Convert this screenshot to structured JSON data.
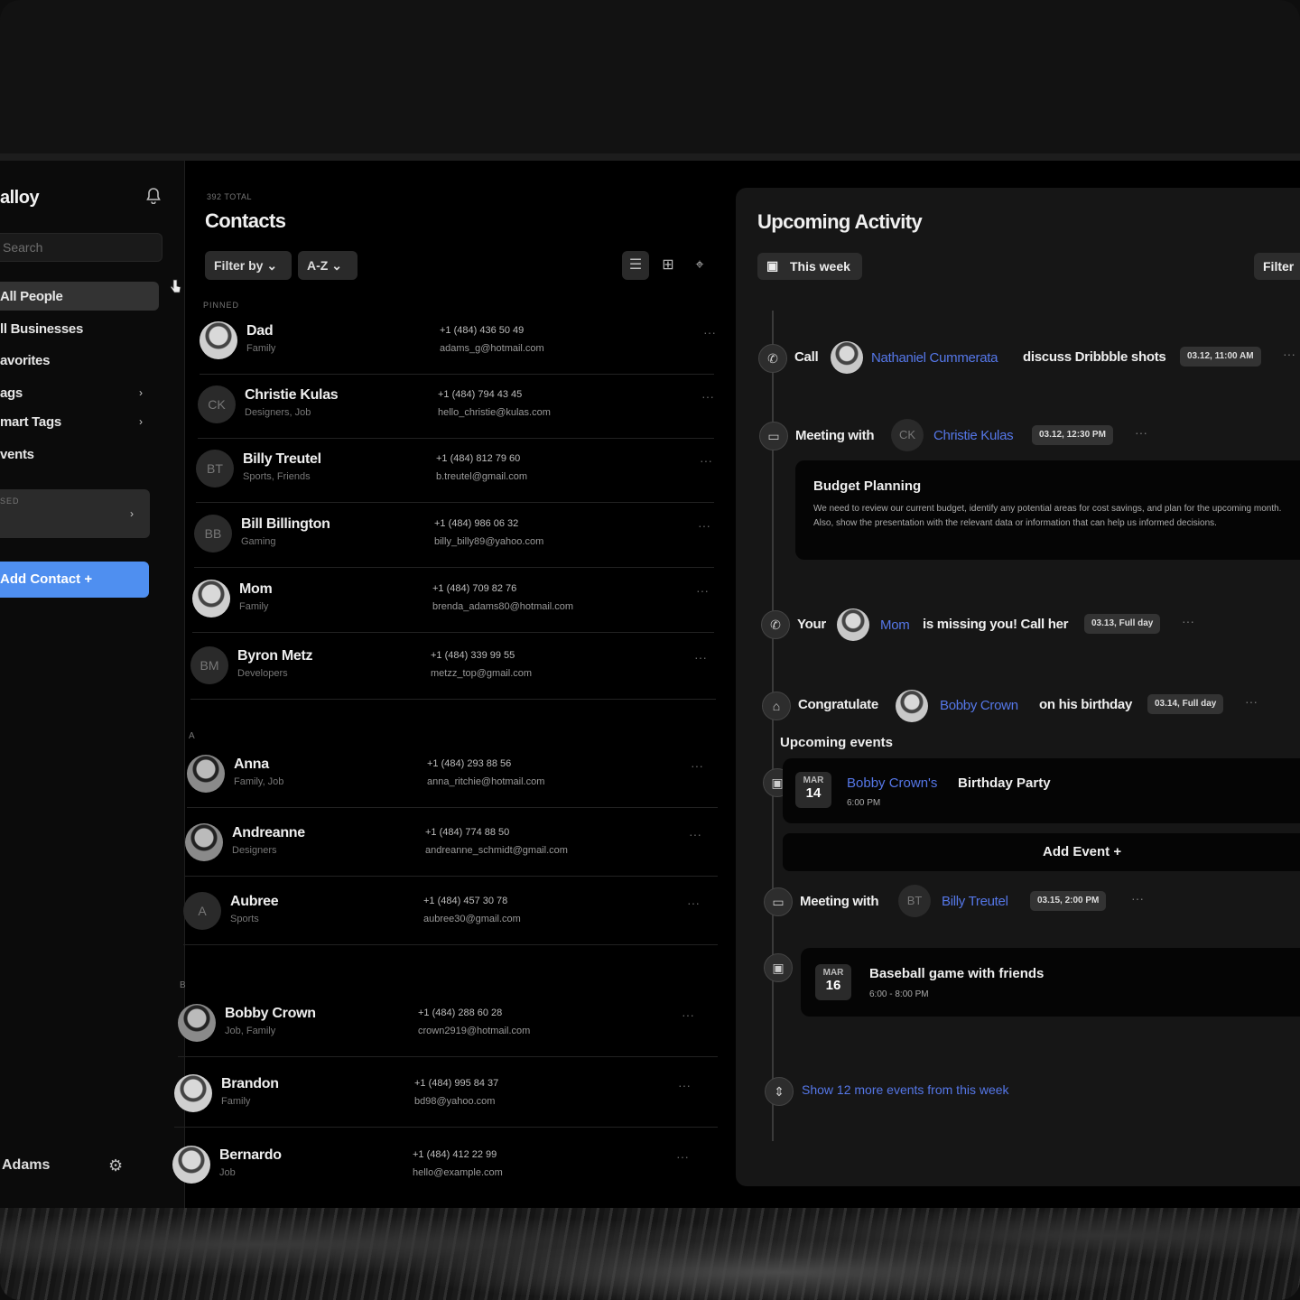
{
  "sidebar": {
    "brand": "alloy",
    "search_placeholder": "Search",
    "nav": [
      {
        "label": "All People"
      },
      {
        "label": "ll Businesses"
      },
      {
        "label": "avorites"
      },
      {
        "label": "ags"
      },
      {
        "label": "mart Tags"
      },
      {
        "label": "vents"
      }
    ],
    "saved_label": "SED",
    "add_contact": "Add Contact +",
    "user_name": "Adams"
  },
  "contacts": {
    "total": "392 TOTAL",
    "title": "Contacts",
    "filter_by": "Filter by ⌄",
    "sort": "A-Z ⌄",
    "pinned_label": "PINNED",
    "section_a": "A",
    "section_b": "B",
    "pinned": [
      {
        "name": "Dad",
        "tags": "Family",
        "phone": "+1 (484) 436 50 49",
        "email": "adams_g@hotmail.com",
        "initials": ""
      },
      {
        "name": "Christie Kulas",
        "tags": "Designers, Job",
        "phone": "+1 (484) 794 43 45",
        "email": "hello_christie@kulas.com",
        "initials": "CK"
      },
      {
        "name": "Billy Treutel",
        "tags": "Sports, Friends",
        "phone": "+1 (484) 812 79 60",
        "email": "b.treutel@gmail.com",
        "initials": "BT"
      },
      {
        "name": "Bill Billington",
        "tags": "Gaming",
        "phone": "+1 (484) 986 06 32",
        "email": "billy_billy89@yahoo.com",
        "initials": "BB"
      },
      {
        "name": "Mom",
        "tags": "Family",
        "phone": "+1 (484) 709 82 76",
        "email": "brenda_adams80@hotmail.com",
        "initials": ""
      },
      {
        "name": "Byron Metz",
        "tags": "Developers",
        "phone": "+1 (484) 339 99 55",
        "email": "metzz_top@gmail.com",
        "initials": "BM"
      }
    ],
    "a_list": [
      {
        "name": "Anna",
        "tags": "Family, Job",
        "phone": "+1 (484) 293 88 56",
        "email": "anna_ritchie@hotmail.com",
        "initials": ""
      },
      {
        "name": "Andreanne",
        "tags": "Designers",
        "phone": "+1 (484) 774 88 50",
        "email": "andreanne_schmidt@gmail.com",
        "initials": ""
      },
      {
        "name": "Aubree",
        "tags": "Sports",
        "phone": "+1 (484) 457 30 78",
        "email": "aubree30@gmail.com",
        "initials": "A"
      }
    ],
    "b_list": [
      {
        "name": "Bobby Crown",
        "tags": "Job, Family",
        "phone": "+1 (484) 288 60 28",
        "email": "crown2919@hotmail.com",
        "initials": ""
      },
      {
        "name": "Brandon",
        "tags": "Family",
        "phone": "+1 (484) 995 84 37",
        "email": "bd98@yahoo.com",
        "initials": ""
      },
      {
        "name": "Bernardo",
        "tags": "Job",
        "phone": "+1 (484) 412 22 99",
        "email": "hello@example.com",
        "initials": ""
      }
    ]
  },
  "activity": {
    "title": "Upcoming Activity",
    "this_week": "This week",
    "filter": "Filter",
    "items": {
      "call_verb": "Call",
      "call_person": "Nathaniel Cummerata",
      "call_rest": "discuss Dribbble shots",
      "call_time": "03.12, 11:00 AM",
      "meet1_verb": "Meeting with",
      "meet1_initials": "CK",
      "meet1_person": "Christie Kulas",
      "meet1_time": "03.12, 12:30 PM",
      "budget_title": "Budget Planning",
      "budget_desc": "We need to review our current budget, identify any potential areas for cost savings, and plan for the upcoming month. Also, show the presentation with the relevant data or information that can help us informed decisions.",
      "mom_verb": "Your",
      "mom_person": "Mom",
      "mom_rest": "is missing you! Call her",
      "mom_time": "03.13, Full day",
      "bday_verb": "Congratulate",
      "bday_person": "Bobby Crown",
      "bday_rest": "on his birthday",
      "bday_time": "03.14, Full day",
      "upcoming_events": "Upcoming events",
      "party_month": "MAR",
      "party_day": "14",
      "party_person": "Bobby Crown's",
      "party_rest": "Birthday Party",
      "party_time": "6:00 PM",
      "add_event": "Add Event +",
      "meet2_verb": "Meeting with",
      "meet2_initials": "BT",
      "meet2_person": "Billy Treutel",
      "meet2_time": "03.15, 2:00 PM",
      "game_month": "MAR",
      "game_day": "16",
      "game_title": "Baseball game with friends",
      "game_time": "6:00 - 8:00 PM",
      "show_more": "Show 12 more events from this week"
    }
  }
}
